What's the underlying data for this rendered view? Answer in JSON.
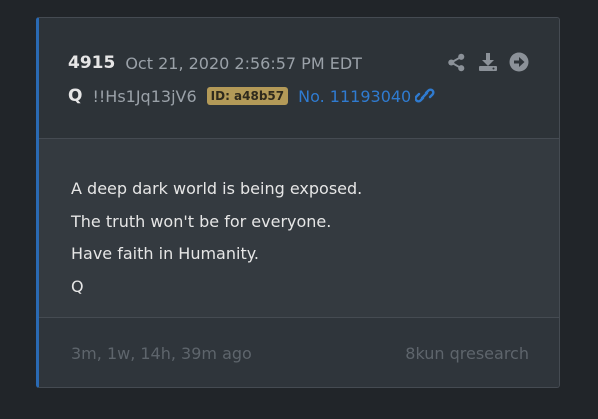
{
  "post": {
    "number": "4915",
    "timestamp": "Oct 21, 2020 2:56:57 PM EDT",
    "author": "Q",
    "tripcode": "!!Hs1Jq13jV6",
    "id_badge": "ID: a48b57",
    "post_link": "No. 11193040"
  },
  "icons": {
    "share": "share-icon",
    "download": "download-icon",
    "go": "arrow-circle-right-icon",
    "link": "link-icon"
  },
  "message": {
    "lines": [
      "A deep dark world is being exposed.",
      "The truth won't be for everyone.",
      "Have faith in Humanity.",
      "Q"
    ]
  },
  "footer": {
    "relative_time": "3m, 1w, 14h, 39m ago",
    "source": "8kun qresearch"
  },
  "colors": {
    "background": "#212529",
    "card": "#343a40",
    "accent_border": "#2a6ab3",
    "link": "#2f7bd0",
    "id_badge": "#b39a58",
    "muted_text": "#5e656c"
  }
}
